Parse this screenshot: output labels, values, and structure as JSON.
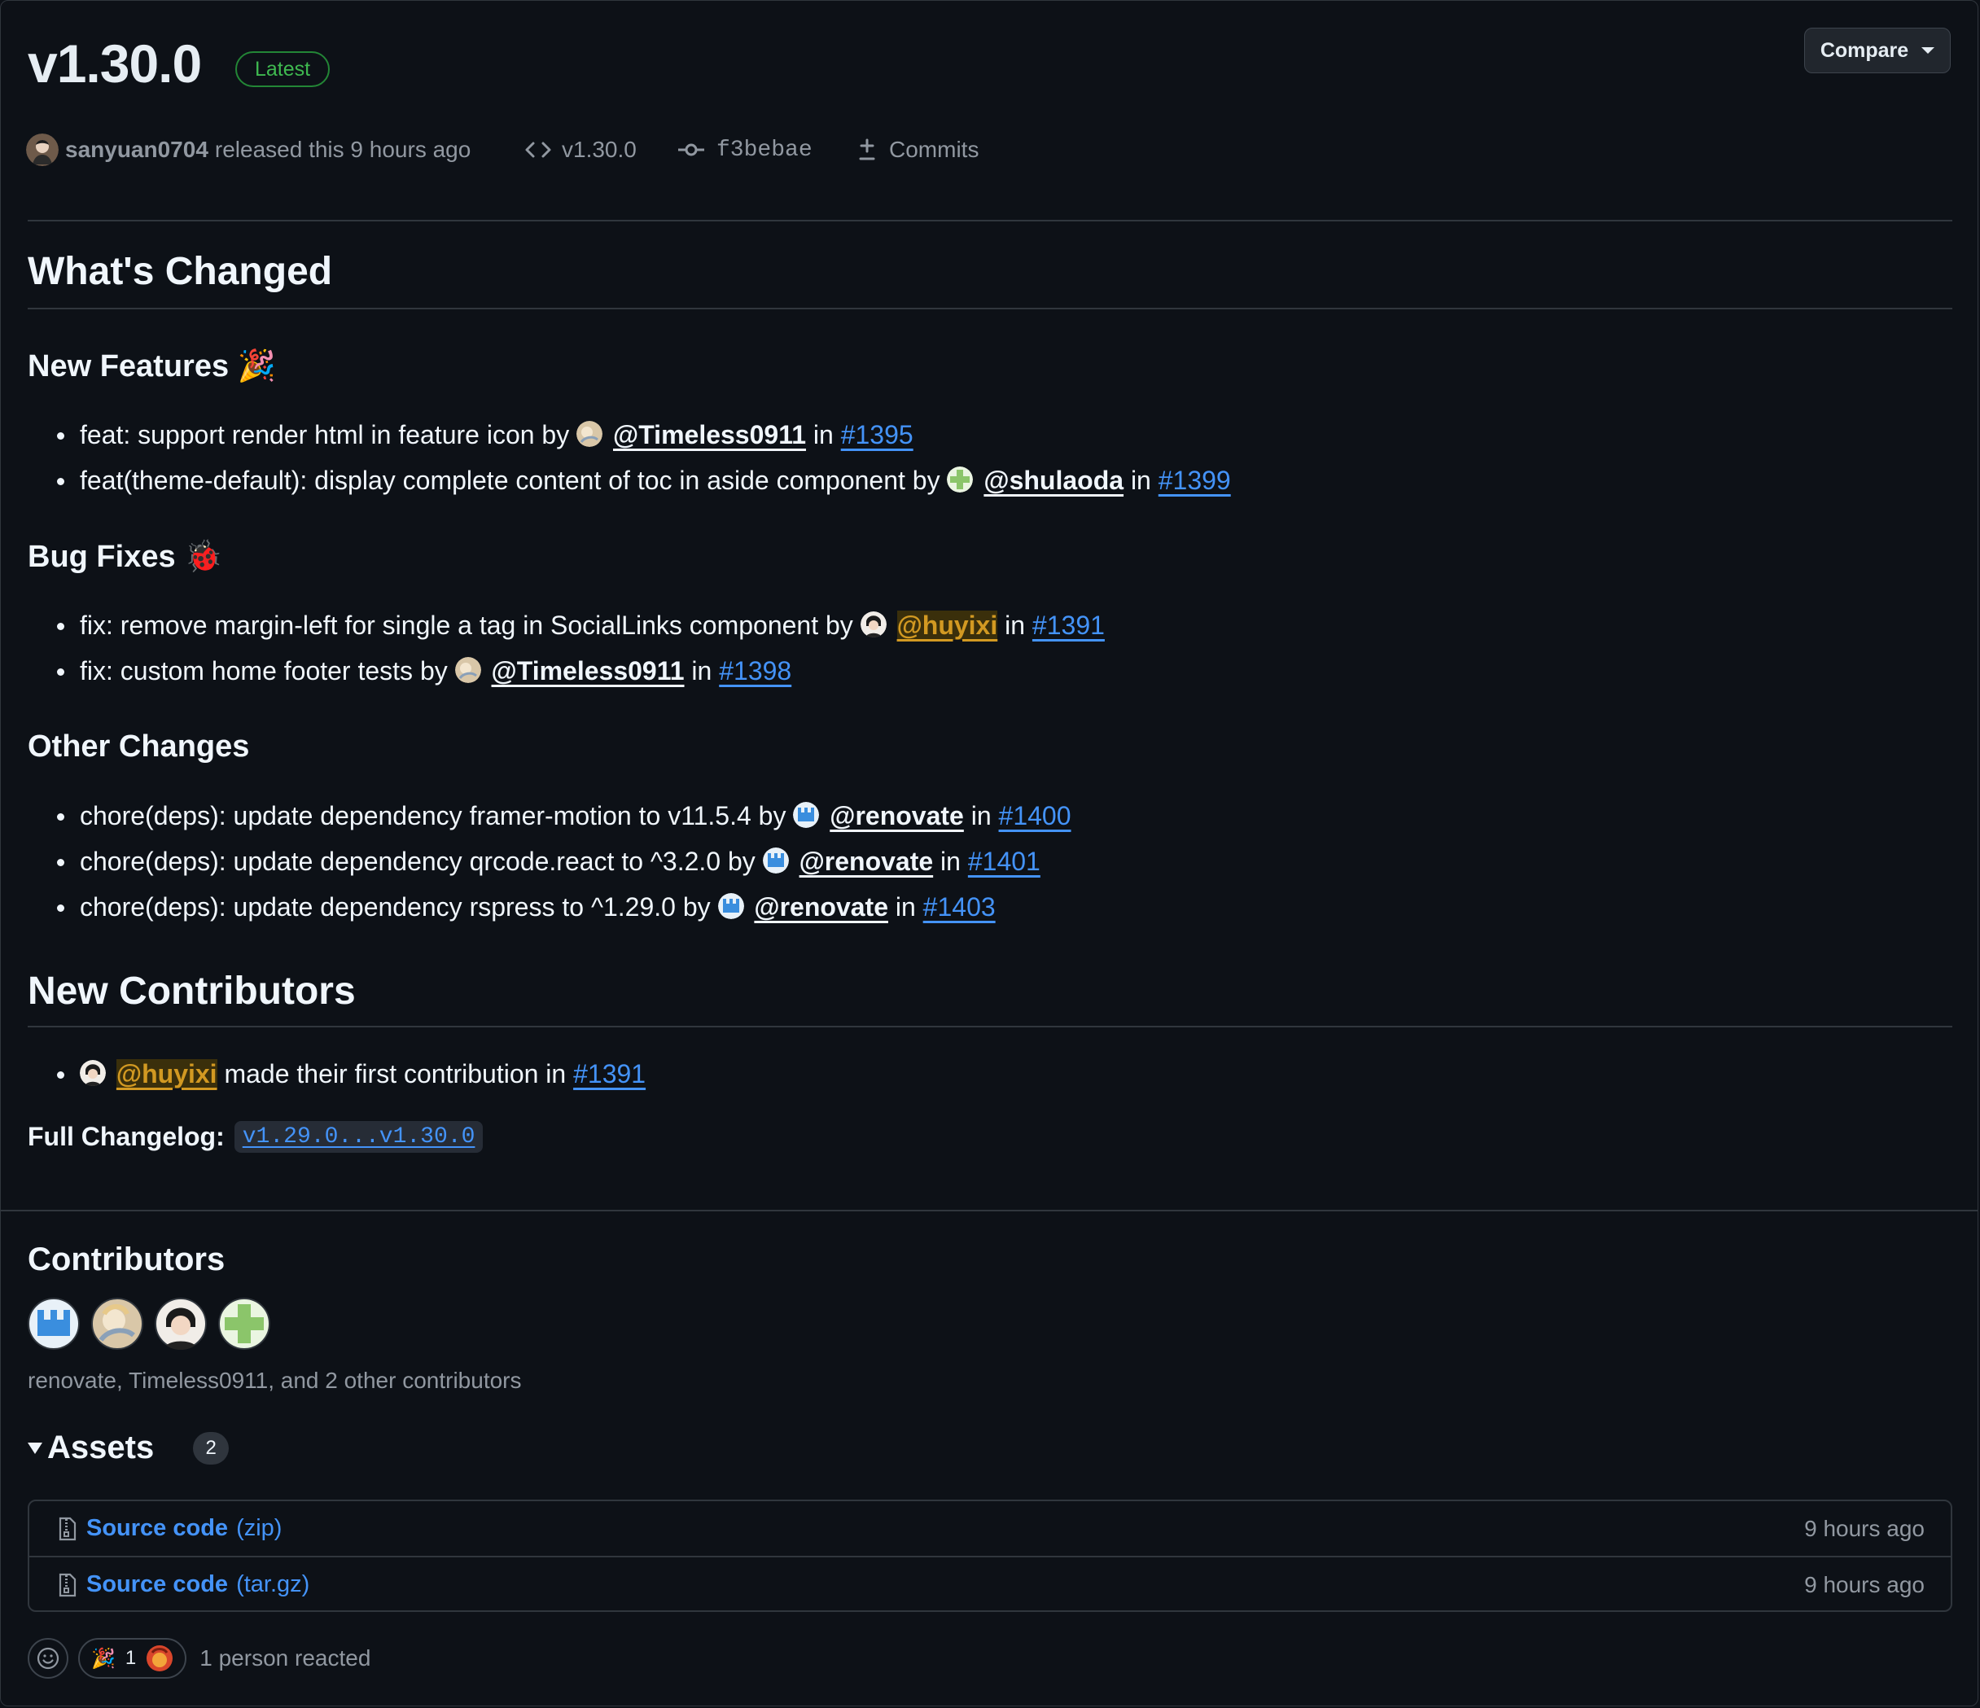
{
  "release": {
    "version": "v1.30.0",
    "latest_label": "Latest",
    "compare_label": "Compare",
    "author": "sanyuan0704",
    "released_text": "released this 9 hours ago",
    "tag": "v1.30.0",
    "commit": "f3bebae",
    "commits_label": "Commits"
  },
  "body": {
    "whats_changed": "What's Changed",
    "sections": [
      {
        "title": "New Features",
        "emoji": "🎉",
        "items": [
          {
            "text": "feat: support render html in feature icon by",
            "user": "@Timeless0911",
            "in": "in",
            "pr": "#1395"
          },
          {
            "text": "feat(theme-default): display complete content of toc in aside component by",
            "user": "@shulaoda",
            "in": "in",
            "pr": "#1399"
          }
        ]
      },
      {
        "title": "Bug Fixes",
        "emoji": "🐞",
        "items": [
          {
            "text": "fix: remove margin-left for single a tag in SocialLinks component by",
            "user": "@huyixi",
            "in": "in",
            "pr": "#1391"
          },
          {
            "text": "fix: custom home footer tests by",
            "user": "@Timeless0911",
            "in": "in",
            "pr": "#1398"
          }
        ]
      },
      {
        "title": "Other Changes",
        "items": [
          {
            "text": "chore(deps): update dependency framer-motion to v11.5.4 by",
            "user": "@renovate",
            "in": "in",
            "pr": "#1400"
          },
          {
            "text": "chore(deps): update dependency qrcode.react to ^3.2.0 by",
            "user": "@renovate",
            "in": "in",
            "pr": "#1401"
          },
          {
            "text": "chore(deps): update dependency rspress to ^1.29.0 by",
            "user": "@renovate",
            "in": "in",
            "pr": "#1403"
          }
        ]
      }
    ],
    "new_contributors_title": "New Contributors",
    "new_contributor": {
      "user": "@huyixi",
      "text": "made their first contribution in",
      "pr": "#1391"
    },
    "full_changelog_label": "Full Changelog:",
    "full_changelog_link": "v1.29.0...v1.30.0"
  },
  "contributors": {
    "title": "Contributors",
    "summary": "renovate, Timeless0911, and 2 other contributors"
  },
  "assets": {
    "title": "Assets",
    "count": "2",
    "items": [
      {
        "name": "Source code",
        "ext": "(zip)",
        "time": "9 hours ago"
      },
      {
        "name": "Source code",
        "ext": "(tar.gz)",
        "time": "9 hours ago"
      }
    ]
  },
  "reactions": {
    "emoji": "🎉",
    "count": "1",
    "summary": "1 person reacted"
  },
  "colors": {
    "background": "#0d1117",
    "link": "#4493f8",
    "latest_green": "#3fb950",
    "muted": "#9198a1"
  }
}
